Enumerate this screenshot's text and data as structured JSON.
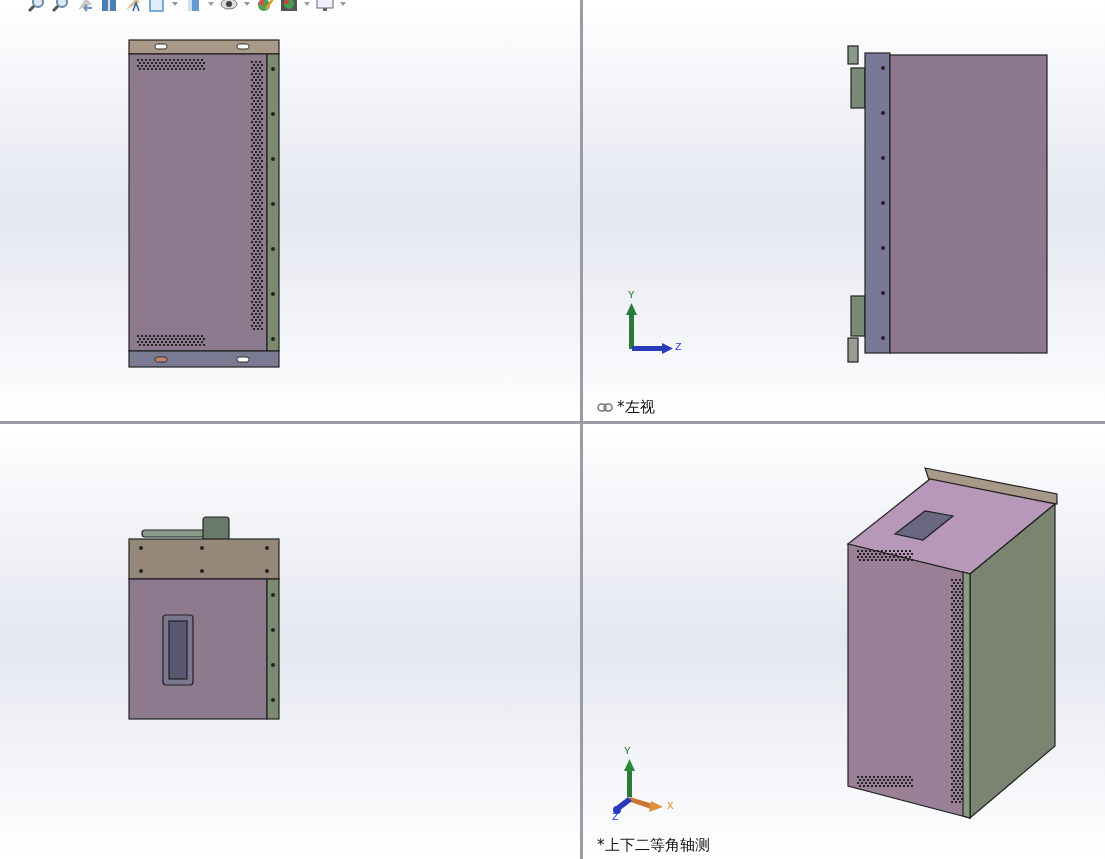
{
  "toolbar": {
    "icons": [
      {
        "kind": "zoom-fit",
        "dropdown": false
      },
      {
        "kind": "zoom-area",
        "dropdown": false
      },
      {
        "kind": "previous-view",
        "dropdown": false
      },
      {
        "kind": "section-view",
        "dropdown": false
      },
      {
        "kind": "dynamic-annotation",
        "dropdown": false
      },
      {
        "kind": "view-orientation",
        "dropdown": true
      },
      {
        "kind": "display-style",
        "dropdown": true
      },
      {
        "kind": "hide-show",
        "dropdown": true
      },
      {
        "kind": "edit-appearance",
        "dropdown": false
      },
      {
        "kind": "scene",
        "dropdown": true
      },
      {
        "kind": "view-settings",
        "dropdown": true
      }
    ]
  },
  "viewports": [
    {
      "kind": "front"
    },
    {
      "kind": "left",
      "label": "*左视",
      "linked": true,
      "triad": {
        "kind": "side",
        "axes": [
          {
            "label": "Y"
          },
          {
            "label": "Z"
          }
        ]
      }
    },
    {
      "kind": "top"
    },
    {
      "kind": "iso",
      "label": "*上下二等角轴测",
      "linked": false,
      "triad": {
        "kind": "iso",
        "axes": [
          {
            "label": "Y"
          },
          {
            "label": "X"
          },
          {
            "label": "Z"
          }
        ]
      }
    }
  ]
}
